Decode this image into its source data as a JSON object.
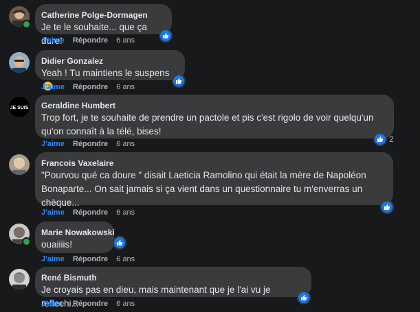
{
  "comments": [
    {
      "author": "Catherine Polge-Dormagen",
      "text": "Je te le souhaite... que ça dure!",
      "like_label": "J'aime",
      "reply_label": "Répondre",
      "time": "6 ans",
      "reaction_count": "",
      "online": true,
      "avatar_icon": "user-photo"
    },
    {
      "author": "Didier Gonzalez",
      "text": "Yeah ! Tu maintiens le suspens",
      "like_label": "J'aime",
      "reply_label": "Répondre",
      "time": "6 ans",
      "reaction_count": "",
      "online": false,
      "emoji": "smirk-emoji"
    },
    {
      "author": "Geraldine Humbert",
      "text": "Trop fort, je te souhaite de prendre un pactole et pis c'est rigolo de voir quelqu'un qu'on connaît à la télé, bises!",
      "like_label": "J'aime",
      "reply_label": "Répondre",
      "time": "6 ans",
      "reaction_count": "2",
      "online": false
    },
    {
      "author": "Francois Vaxelaire",
      "text": "\"Pourvou qué ca doure \" disait Laeticia Ramolino qui était la mère de Napoléon Bonaparte... On sait jamais si ça vient dans un questionnaire tu m'enverras un chèque...",
      "like_label": "J'aime",
      "reply_label": "Répondre",
      "time": "6 ans",
      "reaction_count": "",
      "online": false
    },
    {
      "author": "Marie Nowakowski",
      "text": "ouaiiiis!",
      "like_label": "J'aime",
      "reply_label": "Répondre",
      "time": "6 ans",
      "reaction_count": "",
      "online": true
    },
    {
      "author": "René Bismuth",
      "text": "Je croyais pas en dieu, mais maintenant que je l'ai vu je reflechi...",
      "like_label": "J'aime",
      "reply_label": "Répondre",
      "time": "6 ans",
      "reaction_count": "",
      "online": false
    }
  ],
  "colors": {
    "background": "#18191a",
    "bubble": "#3a3b3c",
    "link_blue": "#2d88ff",
    "like_blue": "#1877f2",
    "online_green": "#31a24c"
  },
  "avatar_marks": {
    "geraldine": "JE SUIS"
  }
}
